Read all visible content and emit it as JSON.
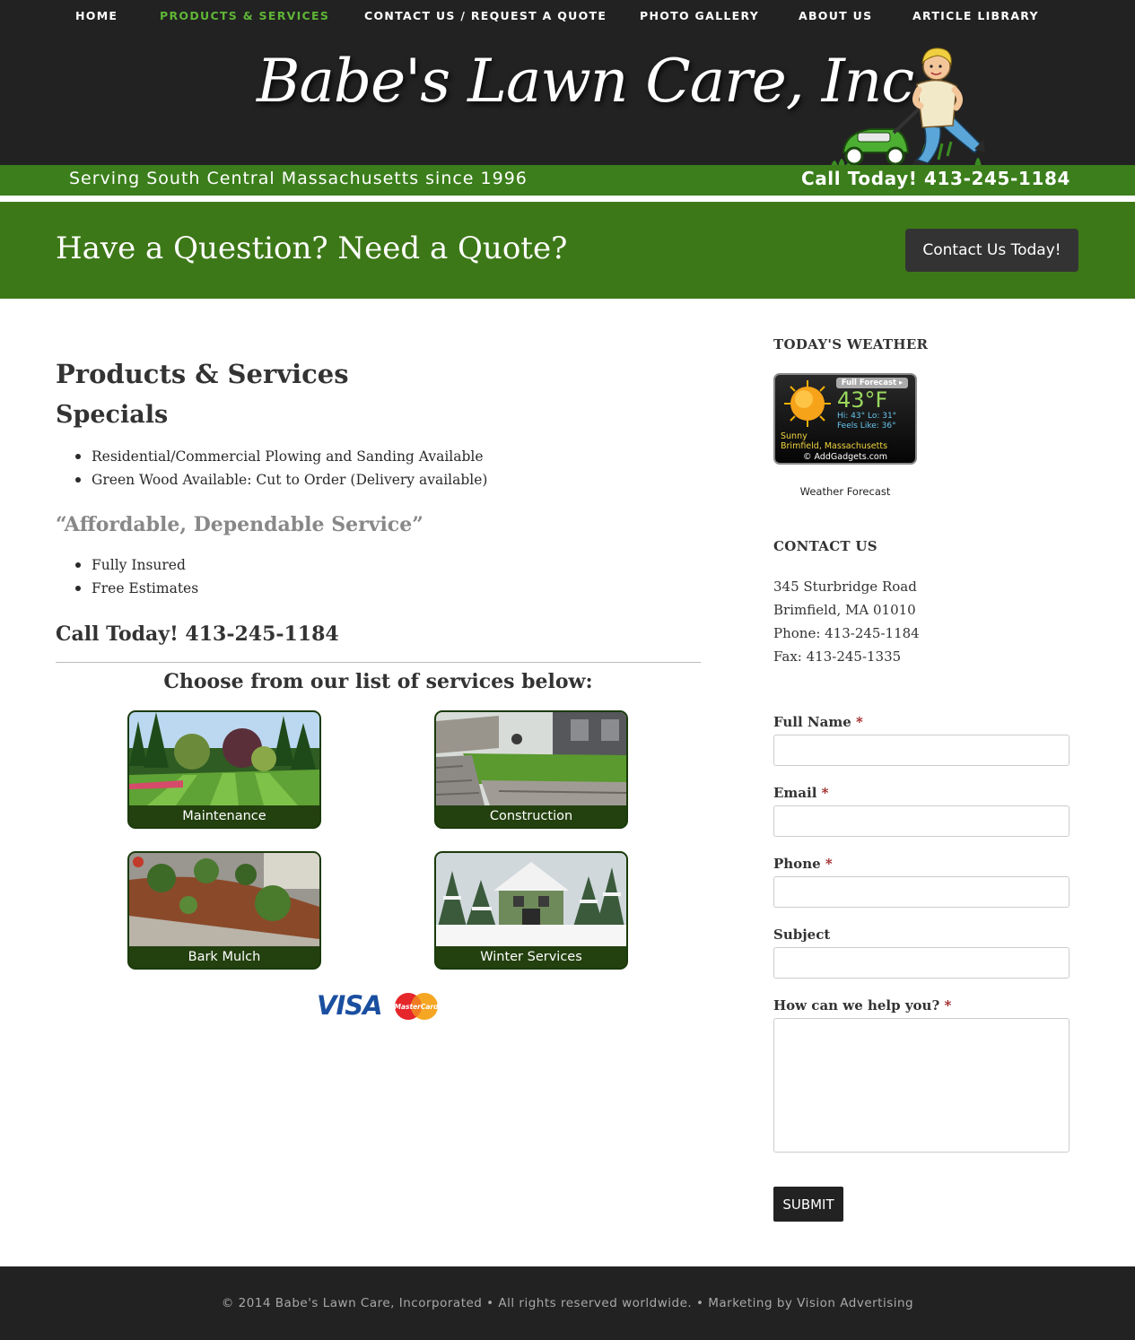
{
  "nav": {
    "items": [
      {
        "label": "HOME",
        "active": false
      },
      {
        "label": "PRODUCTS & SERVICES",
        "active": true
      },
      {
        "label": "CONTACT US / REQUEST A QUOTE",
        "active": false
      },
      {
        "label": "PHOTO GALLERY",
        "active": false
      },
      {
        "label": "ABOUT US",
        "active": false
      },
      {
        "label": "ARTICLE LIBRARY",
        "active": false
      }
    ],
    "active_color": "#5fb536"
  },
  "header": {
    "logo_text": "Babe's Lawn Care, Inc.",
    "tagline": "Serving South Central Massachusetts since 1996",
    "call": "Call Today! 413-245-1184",
    "mascot_icon": "lawnmower-lady-mascot"
  },
  "cta": {
    "title": "Have a Question? Need a Quote?",
    "button": "Contact Us Today!",
    "band_color": "#3d7818"
  },
  "main": {
    "heading": "Products & Services",
    "specials_heading": "Specials",
    "specials": [
      "Residential/Commercial Plowing and Sanding Available",
      "Green Wood Available: Cut to Order (Delivery available)"
    ],
    "affordable_heading": "“Affordable, Dependable Service”",
    "affordable_items": [
      "Fully Insured",
      "Free Estimates"
    ],
    "call_heading": "Call Today! 413-245-1184",
    "choose_heading": "Choose from our list of services below:",
    "services": [
      {
        "label": "Maintenance"
      },
      {
        "label": "Construction"
      },
      {
        "label": "Bark Mulch"
      },
      {
        "label": "Winter Services"
      }
    ],
    "payment": {
      "visa": "VISA",
      "mastercard": "MasterCard"
    }
  },
  "sidebar": {
    "weather_heading": "TODAY'S WEATHER",
    "weather": {
      "forecast_link": "Full Forecast ▸",
      "temp": "43°F",
      "hilo": "Hi: 43°  Lo: 31°",
      "feels": "Feels Like: 36°",
      "condition": "Sunny",
      "location": "Brimfield, Massachusetts",
      "credit": "© AddGadgets.com",
      "icon": "sun-icon"
    },
    "weather_caption": "Weather Forecast",
    "contact_heading": "CONTACT US",
    "address": [
      "345 Sturbridge Road",
      "Brimfield, MA 01010",
      "Phone: 413-245-1184",
      "Fax: 413-245-1335"
    ],
    "form": {
      "full_name": "Full Name",
      "email": "Email",
      "phone": "Phone",
      "subject": "Subject",
      "help": "How can we help you?",
      "required_mark": "*",
      "submit": "SUBMIT"
    }
  },
  "footer": {
    "text": "© 2014 Babe's Lawn Care, Incorporated • All rights reserved worldwide. • Marketing by Vision Advertising"
  }
}
